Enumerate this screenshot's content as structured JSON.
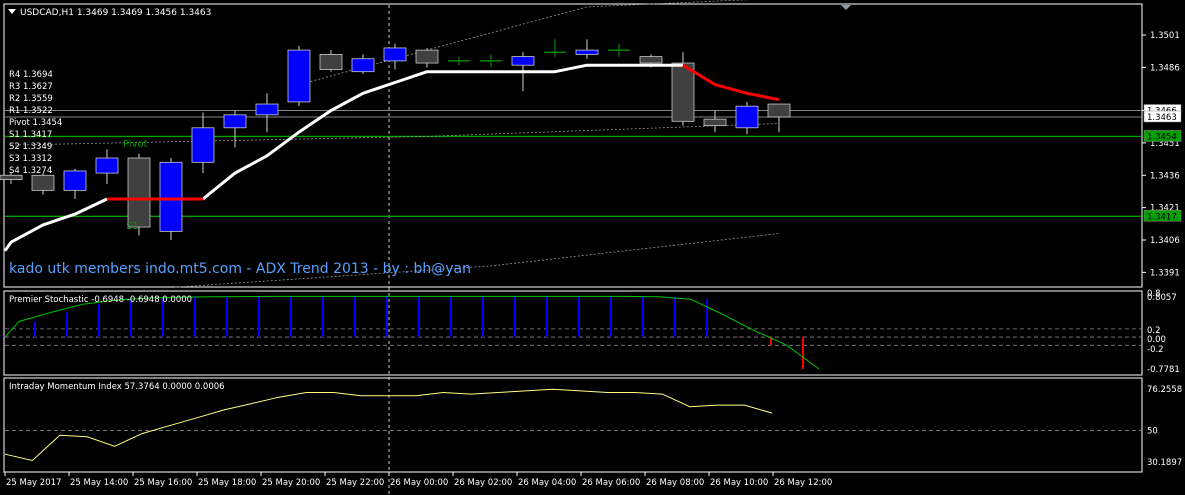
{
  "header": {
    "symbol_line": "USDCAD,H1  1.3469 1.3469 1.3456 1.3463"
  },
  "watermark": {
    "text": "kado utk members indo.mt5.com - ADX Trend 2013 - by : bh@yan"
  },
  "colors": {
    "background": "#000000",
    "bull": "#0000ff",
    "bear": "#404040",
    "neutral": "#00a000",
    "trend_up": "#ffffff",
    "trend_down": "#ff0000",
    "pivot_line": "#00a000",
    "stochastic_line": "#00c000",
    "stochastic_hist": "#0000ff",
    "stochastic_hist_neg": "#ff0000",
    "momentum_line": "#ffff80"
  },
  "pivots": {
    "labels": [
      "R4 1.3694",
      "R3 1.3627",
      "R2 1.3559",
      "R1 1.3522",
      "Pivot 1.3454",
      "S1 1.3417",
      "S2 1.3349",
      "S3 1.3312",
      "S4 1.3274"
    ],
    "pivot_marker": "Pivot",
    "s1_marker": "S1"
  },
  "chart_data": [
    {
      "type": "candlestick",
      "title": "USDCAD,H1",
      "ylim": [
        1.3385,
        1.3515
      ],
      "y_ticks": [
        "1.3501",
        "1.3486",
        "1.3466",
        "1.3451",
        "1.3436",
        "1.3421",
        "1.3406",
        "1.3391"
      ],
      "price_tags": [
        {
          "value": 1.3466,
          "label": "1.3466",
          "style": "white"
        },
        {
          "value": 1.3463,
          "label": "1.3463",
          "style": "white"
        },
        {
          "value": 1.3454,
          "label": "1.3454",
          "style": "green"
        },
        {
          "value": 1.3417,
          "label": "1.3417",
          "style": "green"
        }
      ],
      "x_ticks": [
        "25 May 2017",
        "25 May 14:00",
        "25 May 16:00",
        "25 May 18:00",
        "25 May 20:00",
        "25 May 22:00",
        "26 May 00:00",
        "26 May 02:00",
        "26 May 04:00",
        "26 May 06:00",
        "26 May 08:00",
        "26 May 10:00",
        "26 May 12:00"
      ],
      "candles": [
        {
          "o": 1.3436,
          "h": 1.3437,
          "l": 1.3432,
          "c": 1.3434
        },
        {
          "o": 1.3436,
          "h": 1.3437,
          "l": 1.3427,
          "c": 1.3429
        },
        {
          "o": 1.3429,
          "h": 1.3439,
          "l": 1.3425,
          "c": 1.3438
        },
        {
          "o": 1.3437,
          "h": 1.3448,
          "l": 1.3432,
          "c": 1.3444
        },
        {
          "o": 1.3444,
          "h": 1.3446,
          "l": 1.3408,
          "c": 1.3412
        },
        {
          "o": 1.341,
          "h": 1.3444,
          "l": 1.3406,
          "c": 1.3442
        },
        {
          "o": 1.3442,
          "h": 1.3465,
          "l": 1.3437,
          "c": 1.3458
        },
        {
          "o": 1.3458,
          "h": 1.3466,
          "l": 1.3449,
          "c": 1.3464
        },
        {
          "o": 1.3464,
          "h": 1.3474,
          "l": 1.3456,
          "c": 1.3469
        },
        {
          "o": 1.347,
          "h": 1.3496,
          "l": 1.3468,
          "c": 1.3494
        },
        {
          "o": 1.3492,
          "h": 1.3494,
          "l": 1.3484,
          "c": 1.3485
        },
        {
          "o": 1.3484,
          "h": 1.3492,
          "l": 1.3483,
          "c": 1.349
        },
        {
          "o": 1.3489,
          "h": 1.3497,
          "l": 1.3485,
          "c": 1.3495
        },
        {
          "o": 1.3494,
          "h": 1.3495,
          "l": 1.3486,
          "c": 1.3488
        },
        {
          "o": 1.3489,
          "h": 1.3491,
          "l": 1.3487,
          "c": 1.3489
        },
        {
          "o": 1.3489,
          "h": 1.3492,
          "l": 1.3486,
          "c": 1.3488
        },
        {
          "o": 1.3487,
          "h": 1.3493,
          "l": 1.3475,
          "c": 1.3491
        },
        {
          "o": 1.3492,
          "h": 1.3499,
          "l": 1.3491,
          "c": 1.3493
        },
        {
          "o": 1.3492,
          "h": 1.3499,
          "l": 1.349,
          "c": 1.3494
        },
        {
          "o": 1.3494,
          "h": 1.3497,
          "l": 1.3491,
          "c": 1.3493
        },
        {
          "o": 1.3491,
          "h": 1.3492,
          "l": 1.3486,
          "c": 1.3488
        },
        {
          "o": 1.3488,
          "h": 1.3493,
          "l": 1.3459,
          "c": 1.3461
        },
        {
          "o": 1.3462,
          "h": 1.3466,
          "l": 1.3456,
          "c": 1.3459
        },
        {
          "o": 1.3458,
          "h": 1.347,
          "l": 1.3455,
          "c": 1.3468
        },
        {
          "o": 1.3469,
          "h": 1.3469,
          "l": 1.3456,
          "c": 1.3463
        }
      ],
      "trend_line": {
        "up": [
          1.3405,
          1.3413,
          1.3418,
          1.3425,
          null,
          null,
          1.3425,
          1.3437,
          1.3445,
          1.3456,
          1.3466,
          1.3474,
          1.3479,
          1.3484,
          1.3484,
          1.3484,
          1.3484,
          1.3484,
          1.3487,
          1.3487,
          1.3487,
          1.3487
        ],
        "down": [
          null,
          null,
          null,
          1.3425,
          1.3425,
          1.3425,
          1.3425,
          null,
          null,
          null,
          null,
          null,
          null,
          null,
          null,
          null,
          null,
          null,
          null,
          null,
          null,
          1.3487,
          1.3478,
          1.3474,
          1.3471
        ]
      },
      "channel_upper": [
        [
          9,
          1.3478
        ],
        [
          18,
          1.3514
        ],
        [
          27,
          1.352
        ]
      ],
      "channel_middle": [
        [
          0,
          1.345
        ],
        [
          13,
          1.3454
        ],
        [
          24,
          1.346
        ]
      ],
      "channel_lower": [
        [
          5,
          1.3384
        ],
        [
          15,
          1.3394
        ],
        [
          24,
          1.3409
        ]
      ]
    },
    {
      "type": "line+histogram",
      "title": "Premier Stochastic -0.6948 -0.6948 0.0000",
      "ylim": [
        -0.85,
        1.0
      ],
      "y_ticks": [
        "0.8",
        "0.8057",
        "0.2",
        "0.00",
        "-0.2",
        "-0.7781"
      ],
      "levels": [
        0.2,
        0.0,
        -0.2
      ],
      "line": [
        0.38,
        0.6,
        0.8,
        0.9,
        0.95,
        0.97,
        0.98,
        0.985,
        0.99,
        0.99,
        0.99,
        0.99,
        0.99,
        0.99,
        0.99,
        0.99,
        0.99,
        0.99,
        0.99,
        0.99,
        0.98,
        0.92,
        0.55,
        0.15,
        -0.2,
        -0.78
      ],
      "histogram": [
        0.02,
        0.38,
        0.6,
        0.8,
        0.9,
        0.95,
        0.97,
        0.98,
        0.985,
        0.99,
        0.99,
        0.99,
        0.99,
        0.99,
        0.99,
        0.99,
        0.99,
        0.99,
        0.99,
        0.99,
        0.99,
        0.98,
        0.92,
        0.02,
        -0.2,
        -0.78
      ]
    },
    {
      "type": "line",
      "title": "Intraday Momentum Index 57.3764 0.0000 0.0006",
      "ylim": [
        25,
        80
      ],
      "y_ticks": [
        "76.2558",
        "50",
        "30.1897"
      ],
      "levels": [
        50
      ],
      "values": [
        35,
        31,
        47,
        46,
        40,
        48,
        53,
        58,
        63,
        67,
        71,
        74,
        74,
        72,
        72,
        72,
        74,
        73,
        74,
        75,
        76,
        75,
        74,
        74,
        73,
        65,
        66,
        66,
        61
      ]
    }
  ]
}
